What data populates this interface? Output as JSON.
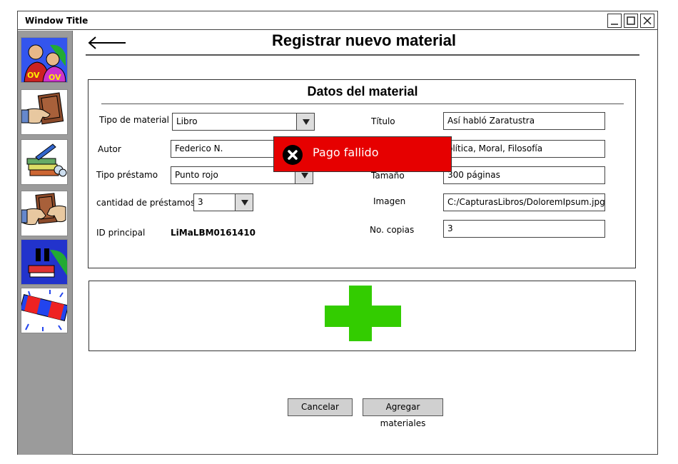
{
  "window": {
    "title": "Window Title"
  },
  "page": {
    "title": "Registrar nuevo material"
  },
  "sidebar": {
    "items": [
      {
        "icon": "people-icon"
      },
      {
        "icon": "book-return-icon"
      },
      {
        "icon": "book-stack-icon"
      },
      {
        "icon": "book-handover-icon"
      },
      {
        "icon": "pause-book-icon"
      },
      {
        "icon": "alert-siren-icon"
      }
    ]
  },
  "form": {
    "section_title": "Datos del material",
    "tipo_material": {
      "label": "Tipo de material",
      "value": "Libro"
    },
    "autor": {
      "label": "Autor",
      "value": "Federico N."
    },
    "tipo_prestamo": {
      "label": "Tipo préstamo",
      "value": "Punto rojo"
    },
    "cantidad": {
      "label": "cantidad de préstamos",
      "value": "3"
    },
    "id_principal": {
      "label": "ID principal",
      "value": "LiMaLBM0161410"
    },
    "titulo": {
      "label": "Título",
      "value": "Así habló Zaratustra"
    },
    "categorias": {
      "label": "",
      "value": "olítica, Moral, Filosofía"
    },
    "tamano": {
      "label": "Tamaño",
      "value": "300 páginas"
    },
    "imagen": {
      "label": "Imagen",
      "value": "C:/CapturasLibros/DoloremIpsum.jpg"
    },
    "copias": {
      "label": "No. copias",
      "value": "3"
    }
  },
  "buttons": {
    "cancel": "Cancelar",
    "add": "Agregar materiales"
  },
  "toast": {
    "message": "Pago fallido",
    "color": "#e60000"
  },
  "colors": {
    "accent_green": "#33cc00",
    "sidebar_bg": "#9b9b9b"
  }
}
